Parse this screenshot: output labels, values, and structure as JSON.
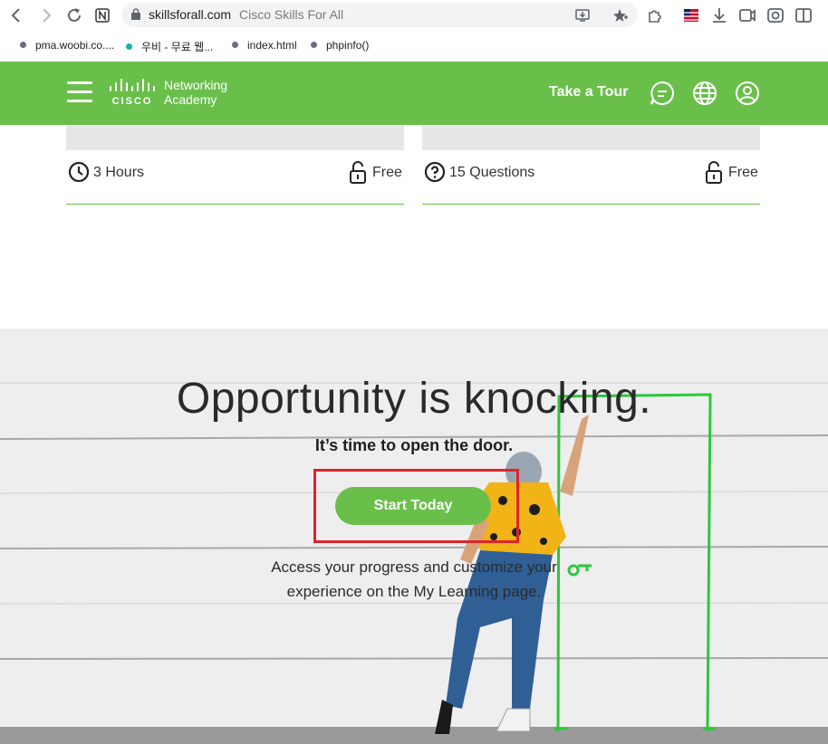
{
  "browser": {
    "url_host": "skillsforall.com",
    "page_title": "Cisco Skills For All",
    "bookmarks": [
      {
        "label": "pma.woobi.co....",
        "color": "#6b6b7b"
      },
      {
        "label": "우비 - 무료 웹...",
        "color": "#17b3a5"
      },
      {
        "label": "index.html",
        "color": "#6b6b7b"
      },
      {
        "label": "phpinfo()",
        "color": "#6b6b7b"
      }
    ]
  },
  "header": {
    "brand_line1": "Networking",
    "brand_line2": "Academy",
    "logo_text": "CISCO",
    "take_tour": "Take a Tour",
    "accent": "#6abf4b"
  },
  "cards": [
    {
      "duration": "3 Hours",
      "price": "Free"
    },
    {
      "duration": "15 Questions",
      "price": "Free"
    }
  ],
  "hero": {
    "headline": "Opportunity is knocking.",
    "subhead": "It’s time to open the door.",
    "cta": "Start Today",
    "desc_line1": "Access your progress and customize your",
    "desc_line2": "experience on the My Learning page."
  }
}
